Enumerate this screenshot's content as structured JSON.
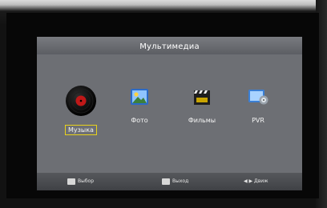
{
  "menu": {
    "title": "Мультимедиа",
    "items": [
      {
        "label": "Музыка",
        "icon": "vinyl-record-icon",
        "selected": true
      },
      {
        "label": "Фото",
        "icon": "photo-icon",
        "selected": false
      },
      {
        "label": "Фильмы",
        "icon": "clapperboard-icon",
        "selected": false
      },
      {
        "label": "PVR",
        "icon": "pvr-recorder-icon",
        "selected": false
      }
    ]
  },
  "footer": {
    "select_hint": "Выбор",
    "exit_hint": "Выход",
    "move_hint": "Движ"
  },
  "colors": {
    "panel": "#6d6f74",
    "selection_border": "#e8d21b",
    "record_red": "#c01818"
  }
}
